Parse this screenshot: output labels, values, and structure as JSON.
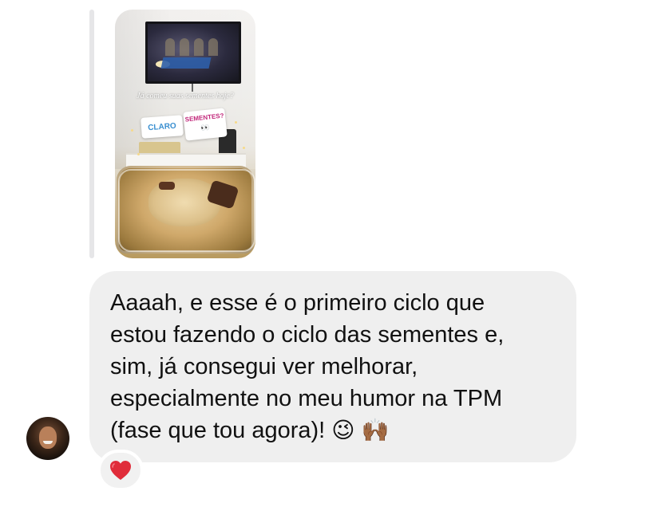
{
  "story": {
    "question": "Já comeu suas sementes hoje?",
    "poll_option_1": "CLARO",
    "poll_option_2": "SEMENTES?",
    "poll_option_2_emoji": "👀"
  },
  "message": {
    "lines": [
      "Aaaah, e esse é o primeiro ciclo que",
      "estou fazendo o ciclo das sementes e,",
      "sim, já consegui ver melhorar,",
      "especialmente no meu humor na TPM",
      "(fase que tou agora)!"
    ],
    "emojis": [
      "😉",
      "🙌🏾"
    ]
  },
  "reaction": {
    "icon": "red-heart-icon",
    "color": "#e02c3a"
  },
  "colors": {
    "bubble": "#efefef",
    "reply_line": "#e6e6e8",
    "text": "#111111"
  }
}
